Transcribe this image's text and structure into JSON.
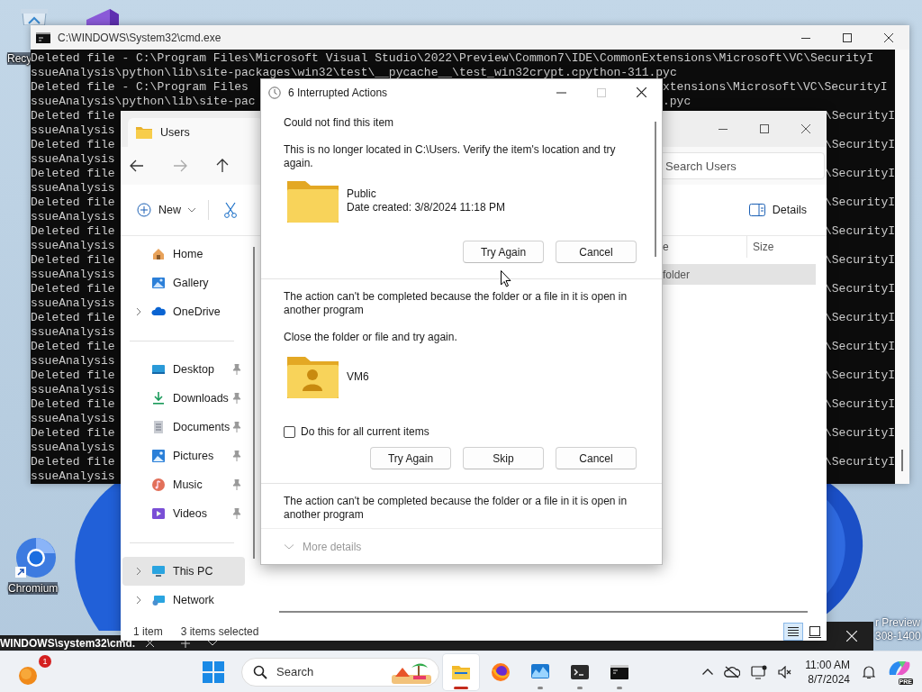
{
  "desktop": {
    "icons": [
      {
        "kind": "recycle-bin",
        "label": "Recy"
      },
      {
        "kind": "visual-studio"
      },
      {
        "kind": "chromium",
        "label": "Chromium"
      }
    ],
    "build_watermark": [
      "r Preview",
      "308-1400"
    ]
  },
  "console": {
    "title": "C:\\WINDOWS\\System32\\cmd.exe",
    "lines": [
      {
        "kind": "full",
        "left": "Deleted file - C:\\Program Files\\Microsoft Visual Studio\\2022\\Preview\\Common7\\IDE\\CommonExtensions\\Microsoft\\VC\\SecurityI"
      },
      {
        "kind": "full",
        "left": "ssueAnalysis\\python\\lib\\site-packages\\win32\\test\\__pycache__\\test_win32crypt.cpython-311.pyc"
      },
      {
        "kind": "tail",
        "left": "Deleted file - C:\\Program Files",
        "right": "xtensions\\Microsoft\\VC\\SecurityI"
      },
      {
        "kind": "tail",
        "left": "ssueAnalysis\\python\\lib\\site-pac",
        "right": ".pyc"
      },
      {
        "kind": "edge",
        "left": "Deleted file",
        "right": "\\SecurityI"
      },
      {
        "kind": "full",
        "left": "ssueAnalysis"
      },
      {
        "kind": "edge",
        "left": "Deleted file",
        "right": "\\SecurityI"
      },
      {
        "kind": "full",
        "left": "ssueAnalysis"
      },
      {
        "kind": "edge",
        "left": "Deleted file",
        "right": "\\SecurityI"
      },
      {
        "kind": "full",
        "left": "ssueAnalysis"
      },
      {
        "kind": "edge",
        "left": "Deleted file",
        "right": "\\SecurityI"
      },
      {
        "kind": "full",
        "left": "ssueAnalysis"
      },
      {
        "kind": "edge",
        "left": "Deleted file",
        "right": "\\SecurityI"
      },
      {
        "kind": "full",
        "left": "ssueAnalysis"
      },
      {
        "kind": "edge",
        "left": "Deleted file",
        "right": "\\SecurityI"
      },
      {
        "kind": "full",
        "left": "ssueAnalysis"
      },
      {
        "kind": "edge",
        "left": "Deleted file",
        "right": "\\SecurityI"
      },
      {
        "kind": "full",
        "left": "ssueAnalysis"
      },
      {
        "kind": "edge",
        "left": "Deleted file",
        "right": "\\SecurityI"
      },
      {
        "kind": "full",
        "left": "ssueAnalysis"
      },
      {
        "kind": "edge",
        "left": "Deleted file",
        "right": "\\SecurityI"
      },
      {
        "kind": "full",
        "left": "ssueAnalysis"
      },
      {
        "kind": "edge",
        "left": "Deleted file",
        "right": "\\SecurityI"
      },
      {
        "kind": "full",
        "left": "ssueAnalysis"
      },
      {
        "kind": "edge",
        "left": "Deleted file",
        "right": "\\SecurityI"
      },
      {
        "kind": "full",
        "left": "ssueAnalysis"
      },
      {
        "kind": "edge",
        "left": "Deleted file",
        "right": "\\SecurityI"
      },
      {
        "kind": "full",
        "left": "ssueAnalysis"
      },
      {
        "kind": "edge",
        "left": "Deleted file",
        "right": "\\SecurityI"
      },
      {
        "kind": "full",
        "left": "ssueAnalysis"
      }
    ]
  },
  "terminal_tab": {
    "title": "WINDOWS\\system32\\cmd."
  },
  "explorer": {
    "tab": "Users",
    "search": {
      "placeholder": "Search Users"
    },
    "toolbar": {
      "new": "New",
      "details": "Details"
    },
    "sidebar": [
      [
        {
          "label": "Home",
          "kind": "home",
          "expandable": false,
          "pinned": false,
          "selected": false
        },
        {
          "label": "Gallery",
          "kind": "gallery",
          "expandable": false,
          "pinned": false,
          "selected": false
        },
        {
          "label": "OneDrive",
          "kind": "cloud",
          "expandable": true,
          "pinned": false,
          "selected": false
        }
      ],
      [
        {
          "label": "Desktop",
          "kind": "desktop",
          "expandable": false,
          "pinned": true,
          "selected": false
        },
        {
          "label": "Downloads",
          "kind": "download",
          "expandable": false,
          "pinned": true,
          "selected": false
        },
        {
          "label": "Documents",
          "kind": "documents",
          "expandable": false,
          "pinned": true,
          "selected": false
        },
        {
          "label": "Pictures",
          "kind": "pictures",
          "expandable": false,
          "pinned": true,
          "selected": false
        },
        {
          "label": "Music",
          "kind": "music",
          "expandable": false,
          "pinned": true,
          "selected": false
        },
        {
          "label": "Videos",
          "kind": "videos",
          "expandable": false,
          "pinned": true,
          "selected": false
        }
      ],
      [
        {
          "label": "This PC",
          "kind": "pc",
          "expandable": true,
          "pinned": false,
          "selected": true
        },
        {
          "label": "Network",
          "kind": "network",
          "expandable": true,
          "pinned": false,
          "selected": false
        }
      ]
    ],
    "columns": [
      "e",
      "Size"
    ],
    "rows": [
      {
        "name": "folder",
        "selected": true
      }
    ],
    "status": {
      "count": "1 item",
      "selection": "3 items selected"
    },
    "views": [
      {
        "kind": "details",
        "selected": true
      },
      {
        "kind": "tiles",
        "selected": false
      }
    ]
  },
  "dialog": {
    "title": "6 Interrupted Actions",
    "sections": [
      {
        "heading": "Could not find this item",
        "message": "This is no longer located in C:\\Users. Verify the item's location and try again.",
        "item": {
          "kind": "folder",
          "name": "Public",
          "detail": "Date created: 3/8/2024 11:18 PM"
        },
        "buttons": [
          "Try Again",
          "Cancel"
        ]
      },
      {
        "message": "The action can't be completed because the folder or a file in it is open in another program",
        "hint": "Close the folder or file and try again.",
        "item": {
          "kind": "user-folder",
          "name": "VM6"
        },
        "checkbox": {
          "label": "Do this for all current items",
          "checked": false
        },
        "buttons": [
          "Try Again",
          "Skip",
          "Cancel"
        ]
      },
      {
        "message": "The action can't be completed because the folder or a file in it is open in another program"
      }
    ],
    "more_details": "More details"
  },
  "taskbar": {
    "notification_badge": "1",
    "search": {
      "placeholder": "Search"
    },
    "apps": [
      {
        "kind": "explorer",
        "running": true,
        "focused": true
      },
      {
        "kind": "firefox",
        "running": false,
        "focused": false
      },
      {
        "kind": "monitor",
        "running": true,
        "focused": false
      },
      {
        "kind": "terminal",
        "running": true,
        "focused": false
      },
      {
        "kind": "cmd",
        "running": true,
        "focused": false
      }
    ],
    "clock": {
      "time": "11:00 AM",
      "date": "8/7/2024"
    },
    "copilot_badge": "PRE"
  }
}
